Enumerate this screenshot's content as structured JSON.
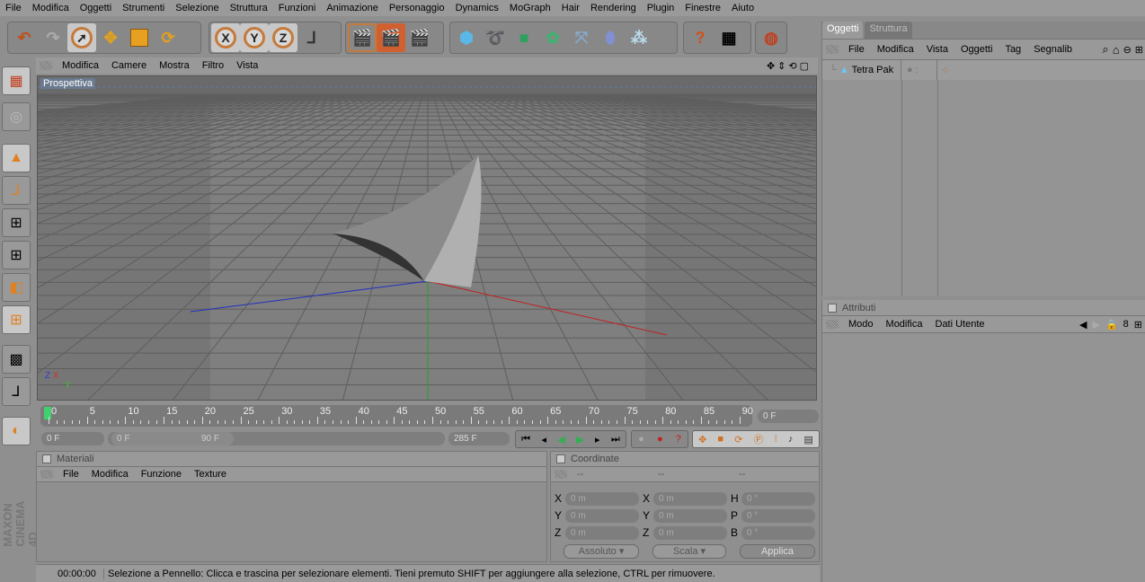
{
  "menu": [
    "File",
    "Modifica",
    "Oggetti",
    "Strumenti",
    "Selezione",
    "Struttura",
    "Funzioni",
    "Animazione",
    "Personaggio",
    "Dynamics",
    "MoGraph",
    "Hair",
    "Rendering",
    "Plugin",
    "Finestre",
    "Aiuto"
  ],
  "toolbar": {
    "axes": [
      "X",
      "Y",
      "Z"
    ]
  },
  "viewport": {
    "menu": [
      "Modifica",
      "Camere",
      "Mostra",
      "Filtro",
      "Vista"
    ],
    "label": "Prospettiva",
    "axis_x": "X",
    "axis_y": "Y",
    "axis_z": "Z"
  },
  "timeline": {
    "ticks": [
      "0",
      "5",
      "10",
      "15",
      "20",
      "25",
      "30",
      "35",
      "40",
      "45",
      "50",
      "55",
      "60",
      "65",
      "70",
      "75",
      "80",
      "85",
      "90"
    ],
    "current": "0 F",
    "start": "0 F",
    "range_start": "0 F",
    "range_end": "90 F",
    "end": "285 F",
    "progress": 0
  },
  "objects": {
    "tabs": [
      "Oggetti",
      "Struttura"
    ],
    "menu": [
      "File",
      "Modifica",
      "Vista",
      "Oggetti",
      "Tag",
      "Segnalib"
    ],
    "items": [
      {
        "name": "Tetra Pak"
      }
    ]
  },
  "attributes": {
    "title": "Attributi",
    "menu": [
      "Modo",
      "Modifica",
      "Dati Utente"
    ]
  },
  "materials": {
    "title": "Materiali",
    "menu": [
      "File",
      "Modifica",
      "Funzione",
      "Texture"
    ]
  },
  "coordinates": {
    "title": "Coordinate",
    "cols": [
      "--",
      "--",
      "--"
    ],
    "rows": [
      {
        "a": "X",
        "av": "0 m",
        "b": "X",
        "bv": "0 m",
        "c": "H",
        "cv": "0 °"
      },
      {
        "a": "Y",
        "av": "0 m",
        "b": "Y",
        "bv": "0 m",
        "c": "P",
        "cv": "0 °"
      },
      {
        "a": "Z",
        "av": "0 m",
        "b": "Z",
        "bv": "0 m",
        "c": "B",
        "cv": "0 °"
      }
    ],
    "mode": "Assoluto",
    "type": "Scala",
    "apply": "Applica"
  },
  "status": {
    "time": "00:00:00",
    "message": "Selezione a Pennello: Clicca e trascina per selezionare elementi. Tieni premuto SHIFT per aggiungere alla selezione, CTRL per rimuovere."
  },
  "brand": "MAXON CINEMA 4D",
  "colors": {
    "accent": "#c57a3c",
    "x_axis": "#c02020",
    "y_axis": "#20a020",
    "z_axis": "#2030c0"
  }
}
